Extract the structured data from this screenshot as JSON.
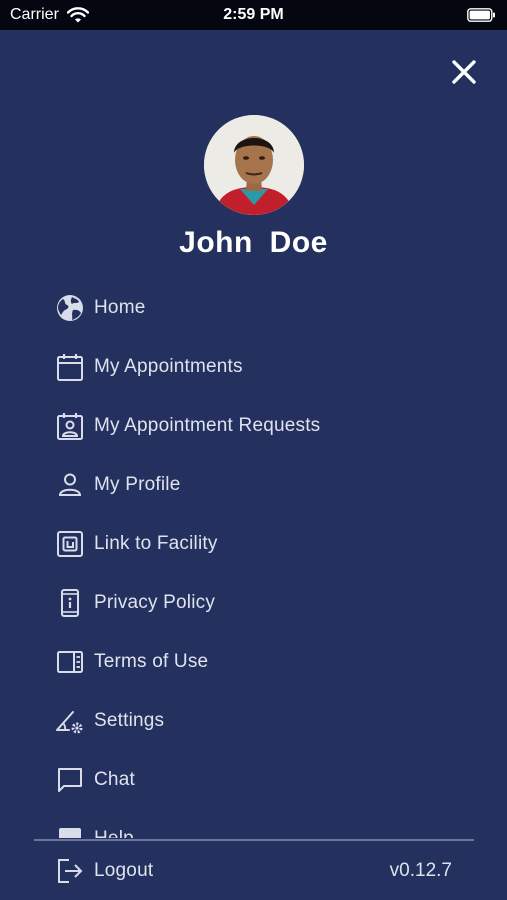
{
  "status_bar": {
    "carrier": "Carrier",
    "time": "2:59 PM",
    "wifi_icon": "wifi-icon",
    "battery_icon": "battery-icon"
  },
  "drawer": {
    "close_icon": "close-icon",
    "user_name": "John  Doe",
    "menu_items": [
      {
        "label": "Home",
        "icon": "globe-icon"
      },
      {
        "label": "My Appointments",
        "icon": "calendar-icon"
      },
      {
        "label": "My Appointment Requests",
        "icon": "calendar-person-icon"
      },
      {
        "label": "My Profile",
        "icon": "person-icon"
      },
      {
        "label": "Link to Facility",
        "icon": "link-facility-icon"
      },
      {
        "label": "Privacy Policy",
        "icon": "privacy-phone-icon"
      },
      {
        "label": "Terms of Use",
        "icon": "terms-panel-icon"
      },
      {
        "label": "Settings",
        "icon": "settings-gear-icon"
      },
      {
        "label": "Chat",
        "icon": "chat-bubble-icon"
      },
      {
        "label": "Help",
        "icon": "help-icon"
      }
    ],
    "logout_label": "Logout",
    "logout_icon": "logout-icon",
    "version": "v0.12.7"
  },
  "colors": {
    "background": "#24305e",
    "status_bar": "#050710",
    "text": "#dfe3ee",
    "divider": "#6c779e"
  }
}
